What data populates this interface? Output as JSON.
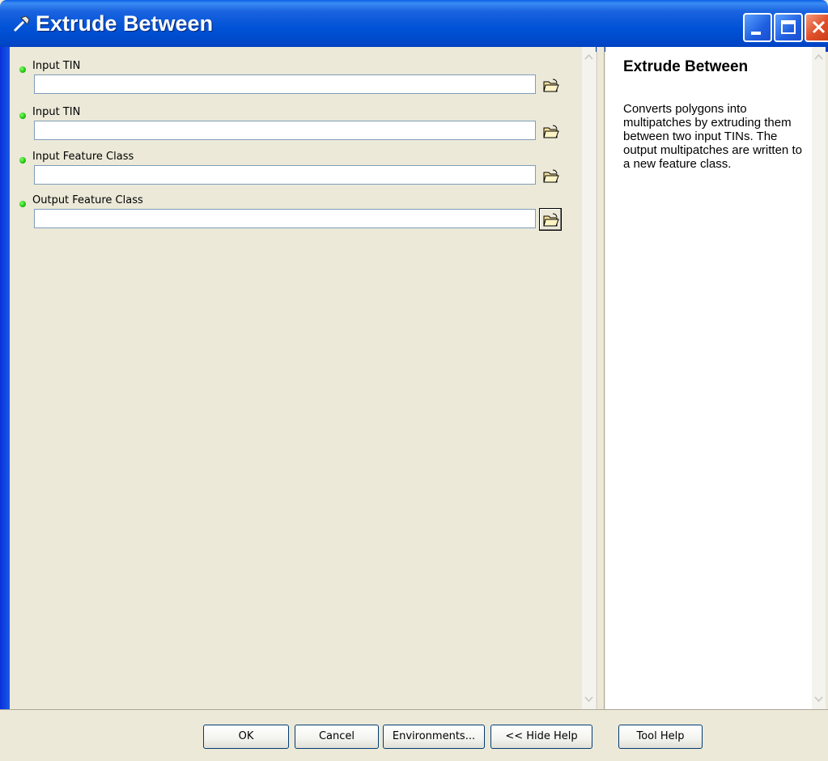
{
  "window": {
    "title": "Extrude Between",
    "title_icon": "hammer-icon"
  },
  "parameters": [
    {
      "label": "Input TIN",
      "value": "",
      "required": true
    },
    {
      "label": "Input TIN",
      "value": "",
      "required": true
    },
    {
      "label": "Input Feature Class",
      "value": "",
      "required": true
    },
    {
      "label": "Output Feature Class",
      "value": "",
      "required": true
    }
  ],
  "help": {
    "title": "Extrude Between",
    "body": "Converts polygons into multipatches by extruding them between two input TINs. The output multipatches are written to a new feature class."
  },
  "buttons": {
    "ok": "OK",
    "cancel": "Cancel",
    "environments": "Environments...",
    "hide_help": "<< Hide Help",
    "tool_help": "Tool Help"
  },
  "colors": {
    "title_bar": "#0052d6",
    "required_dot": "#14b800",
    "dialog_bg": "#ece9d8"
  }
}
